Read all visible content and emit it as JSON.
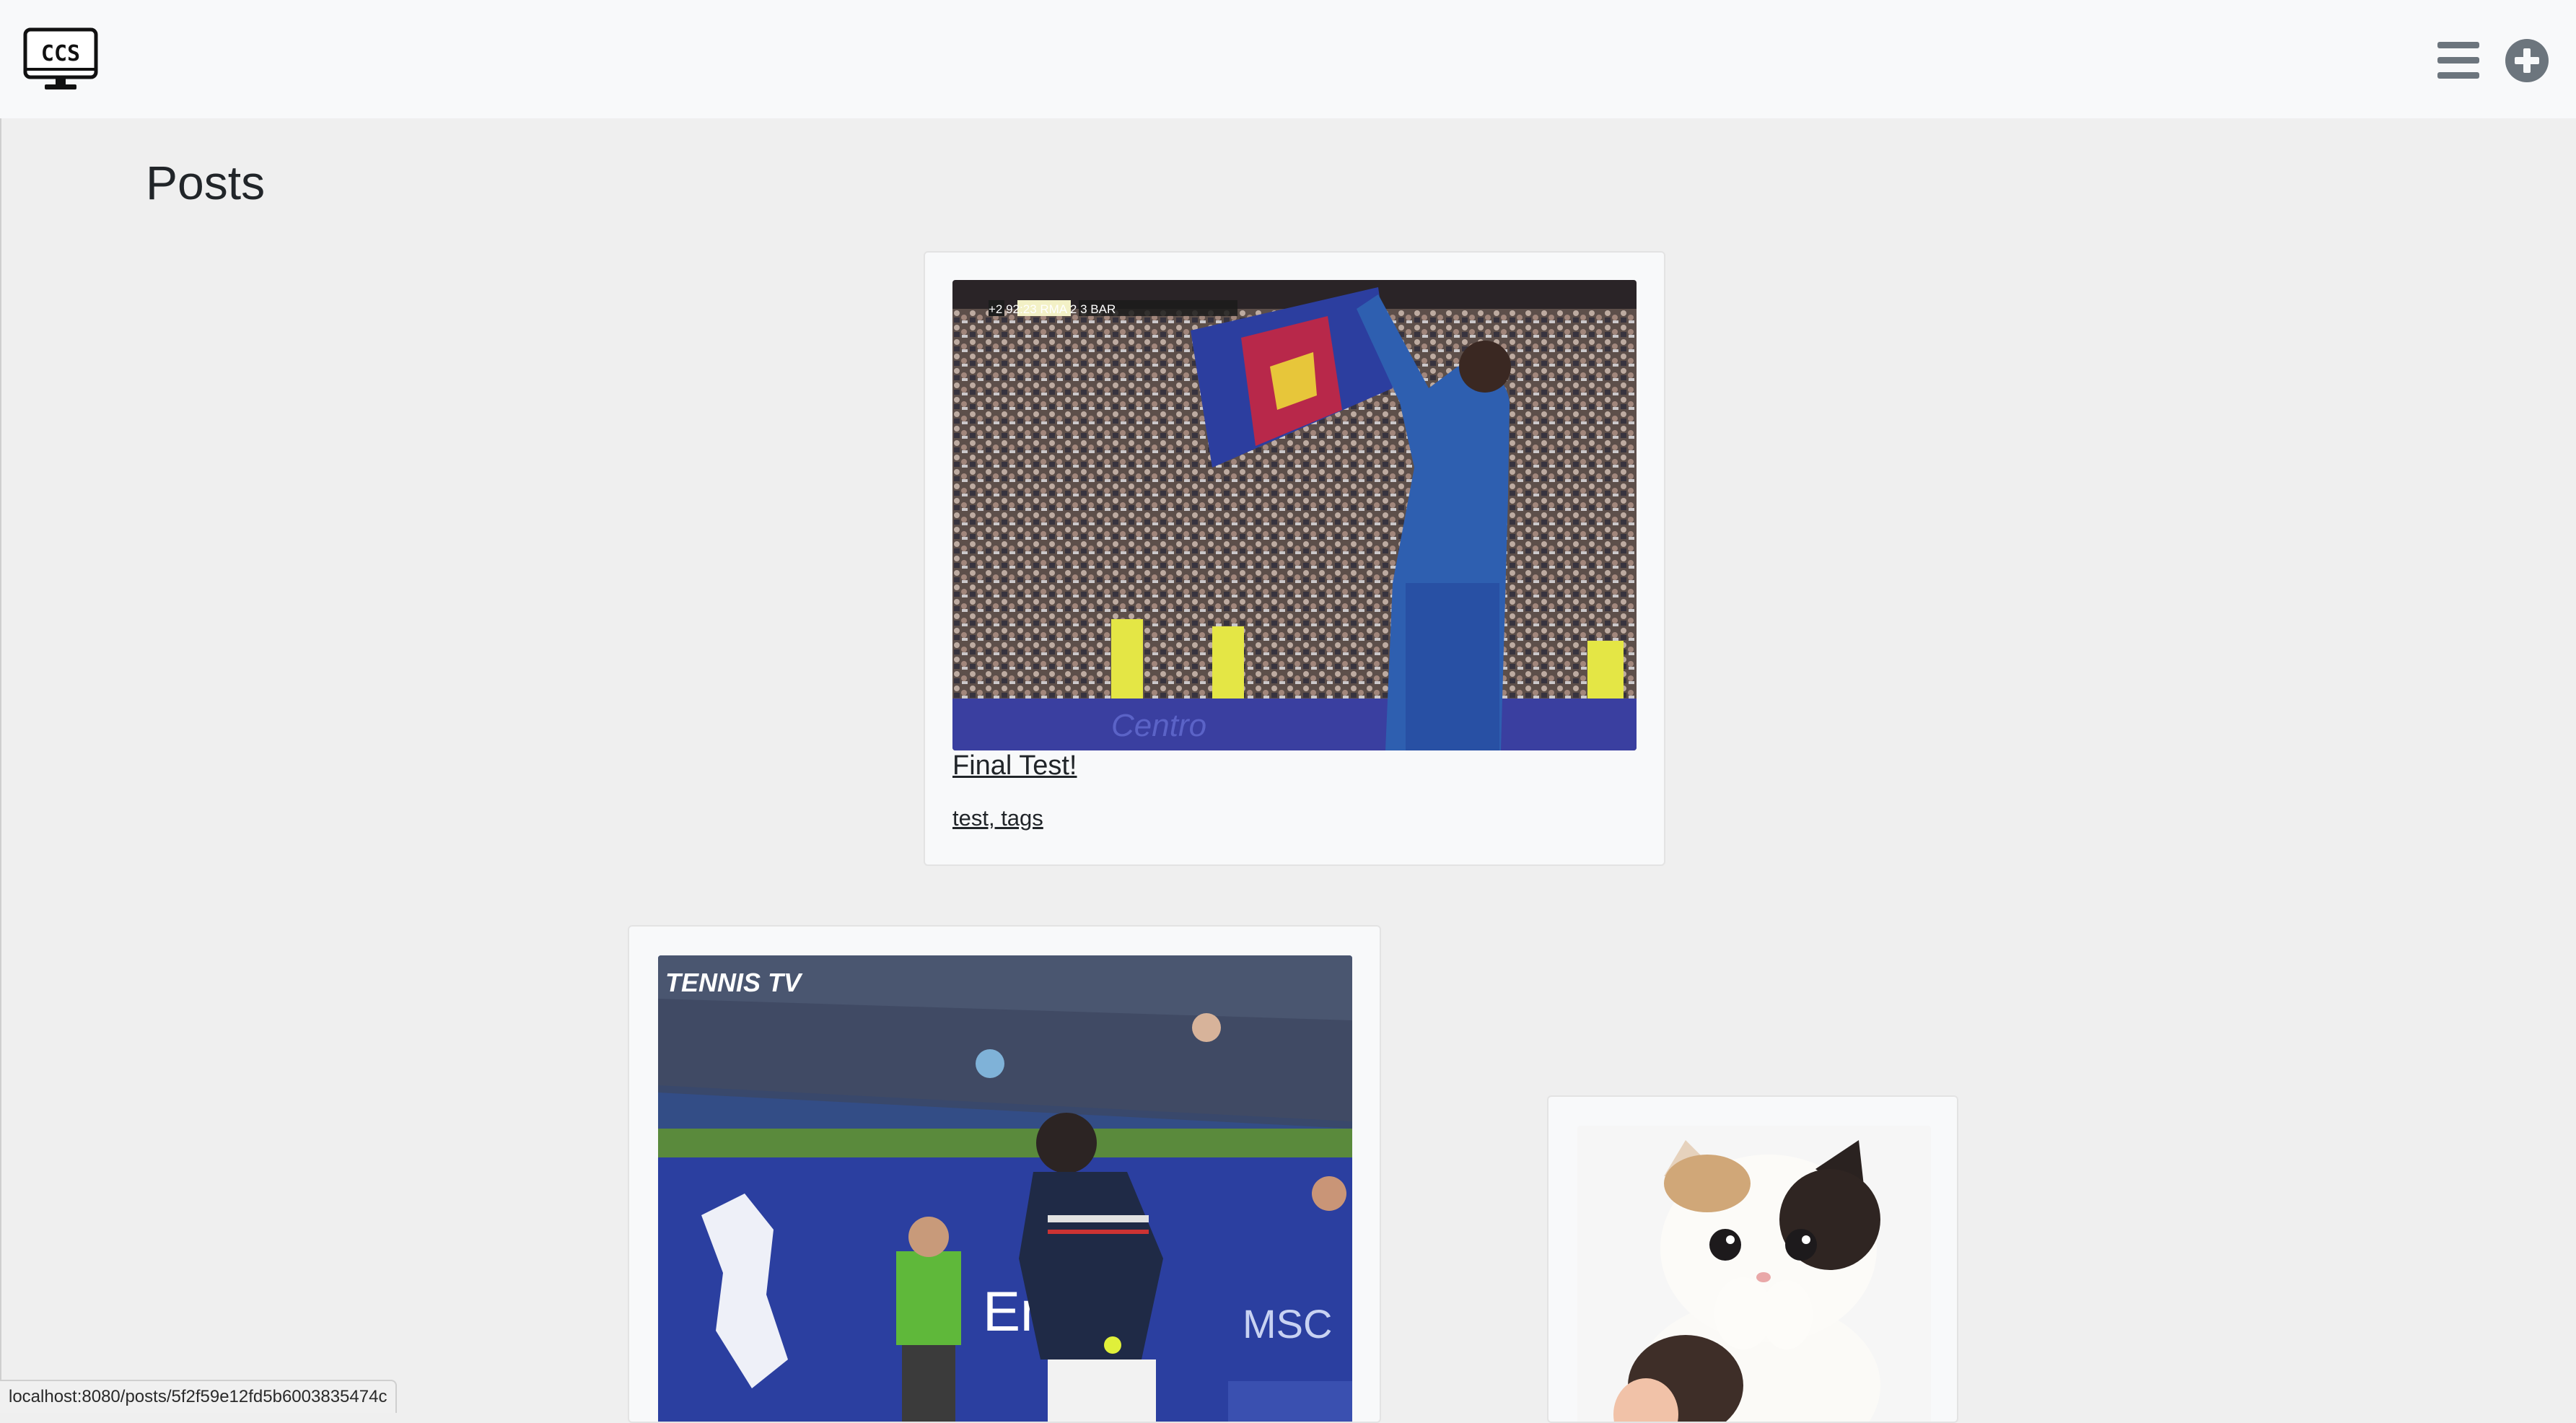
{
  "brand": {
    "logo_text": "CCS"
  },
  "nav": {
    "menu_icon": "hamburger-menu-icon",
    "add_icon": "plus-circle-icon"
  },
  "page": {
    "title": "Posts"
  },
  "posts": [
    {
      "title": "Final Test!",
      "tags": "test, tags",
      "image_overlay": "+2 92:23 RMA 2 3 BAR"
    },
    {
      "title": "",
      "tags": "",
      "image_overlay": "TENNIS TV"
    },
    {
      "title": "",
      "tags": "",
      "image_overlay": ""
    }
  ],
  "status_bar": {
    "url": "localhost:8080/posts/5f2f59e12fd5b6003835474c"
  },
  "colors": {
    "navbar_bg": "#f8f9fa",
    "page_bg": "#efefef",
    "icon_gray": "#6c757d"
  }
}
